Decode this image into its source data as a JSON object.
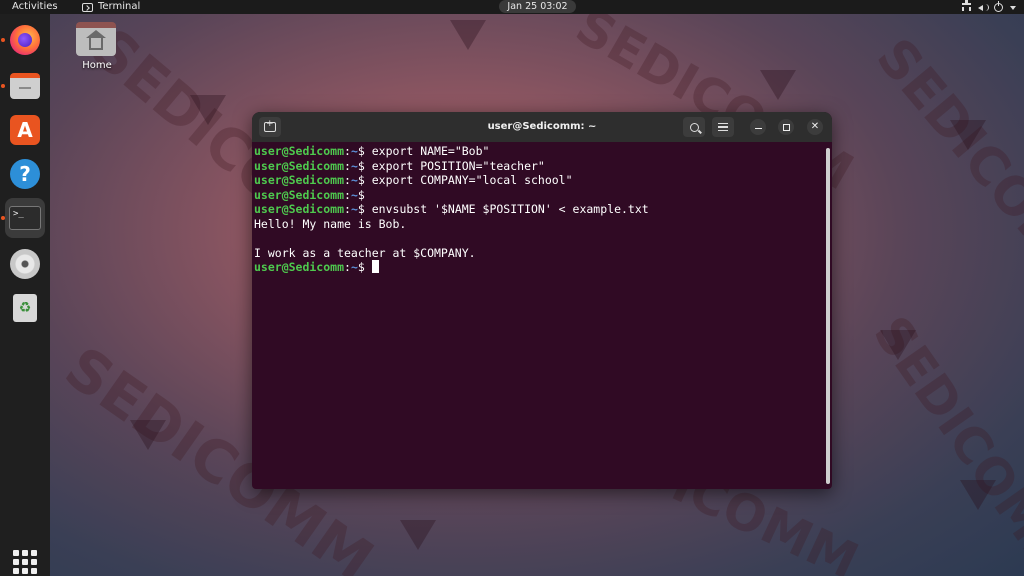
{
  "topbar": {
    "activities": "Activities",
    "app_name": "Terminal",
    "clock": "Jan 25  03:02"
  },
  "desktop": {
    "home_label": "Home",
    "watermark": "SEDICOMM"
  },
  "terminal": {
    "title": "user@Sedicomm: ~",
    "prompt_user": "user@Sedicomm",
    "prompt_sep": ":",
    "prompt_path": "~",
    "prompt_end": "$ ",
    "lines": [
      {
        "type": "cmd",
        "text": "export NAME=\"Bob\""
      },
      {
        "type": "cmd",
        "text": "export POSITION=\"teacher\""
      },
      {
        "type": "cmd",
        "text": "export COMPANY=\"local school\""
      },
      {
        "type": "cmd",
        "text": ""
      },
      {
        "type": "cmd",
        "text": "envsubst '$NAME $POSITION' < example.txt"
      },
      {
        "type": "out",
        "text": "Hello! My name is Bob."
      },
      {
        "type": "out",
        "text": ""
      },
      {
        "type": "out",
        "text": "I work as a teacher at $COMPANY."
      },
      {
        "type": "cursor",
        "text": ""
      }
    ]
  },
  "colors": {
    "terminal_bg": "#300a24",
    "prompt_user": "#4ec94e",
    "prompt_path": "#5c8fd6",
    "accent": "#e95420"
  }
}
